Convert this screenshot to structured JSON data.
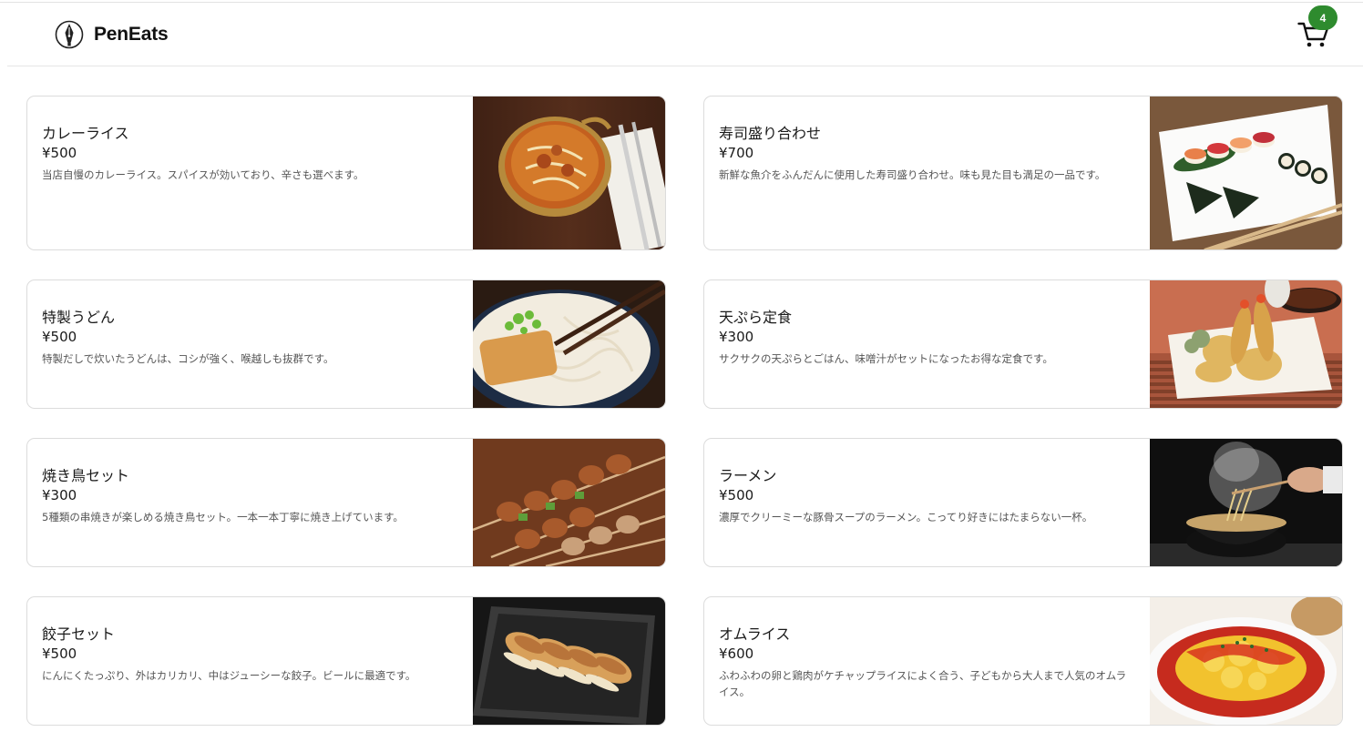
{
  "brand": {
    "name": "PenEats"
  },
  "cart": {
    "count": "4"
  },
  "menu": [
    {
      "name": "カレーライス",
      "price": "¥500",
      "description": "当店自慢のカレーライス。スパイスが効いており、辛さも選べます。",
      "image": "curry-photo"
    },
    {
      "name": "寿司盛り合わせ",
      "price": "¥700",
      "description": "新鮮な魚介をふんだんに使用した寿司盛り合わせ。味も見た目も満足の一品です。",
      "image": "sushi-photo"
    },
    {
      "name": "特製うどん",
      "price": "¥500",
      "description": "特製だしで炊いたうどんは、コシが強く、喉越しも抜群です。",
      "image": "udon-photo"
    },
    {
      "name": "天ぷら定食",
      "price": "¥300",
      "description": "サクサクの天ぷらとごはん、味噌汁がセットになったお得な定食です。",
      "image": "tempura-photo"
    },
    {
      "name": "焼き鳥セット",
      "price": "¥300",
      "description": "5種類の串焼きが楽しめる焼き鳥セット。一本一本丁寧に焼き上げています。",
      "image": "yakitori-photo"
    },
    {
      "name": "ラーメン",
      "price": "¥500",
      "description": "濃厚でクリーミーな豚骨スープのラーメン。こってり好きにはたまらない一杯。",
      "image": "ramen-photo"
    },
    {
      "name": "餃子セット",
      "price": "¥500",
      "description": "にんにくたっぷり、外はカリカリ、中はジューシーな餃子。ビールに最適です。",
      "image": "gyoza-photo"
    },
    {
      "name": "オムライス",
      "price": "¥600",
      "description": "ふわふわの卵と鶏肉がケチャップライスによく合う、子どもから大人まで人気のオムライス。",
      "image": "omurice-photo"
    }
  ],
  "colors": {
    "badge": "#2e8b2e",
    "border": "#dcdcdc",
    "text": "#1a1a1a",
    "muted": "#555555"
  }
}
